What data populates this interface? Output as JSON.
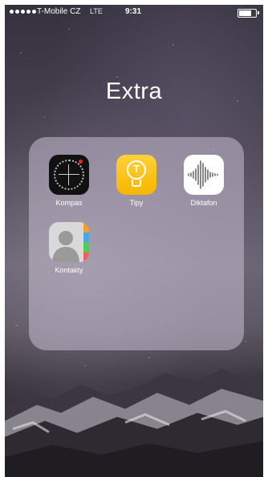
{
  "status_bar": {
    "carrier": "T-Mobile CZ",
    "network": "LTE",
    "time": "9:31",
    "battery_level": 0.85
  },
  "folder": {
    "title": "Extra",
    "apps": [
      {
        "label": "Kompas",
        "icon": "compass-icon"
      },
      {
        "label": "Tipy",
        "icon": "lightbulb-icon"
      },
      {
        "label": "Diktafon",
        "icon": "waveform-icon"
      },
      {
        "label": "Kontakty",
        "icon": "contacts-icon"
      }
    ]
  },
  "colors": {
    "tips_yellow": "#f7b500",
    "compass_red": "#e02b1f",
    "contacts_tabs": [
      "#f0a030",
      "#4aa8e8",
      "#58c858",
      "#f06060"
    ]
  }
}
